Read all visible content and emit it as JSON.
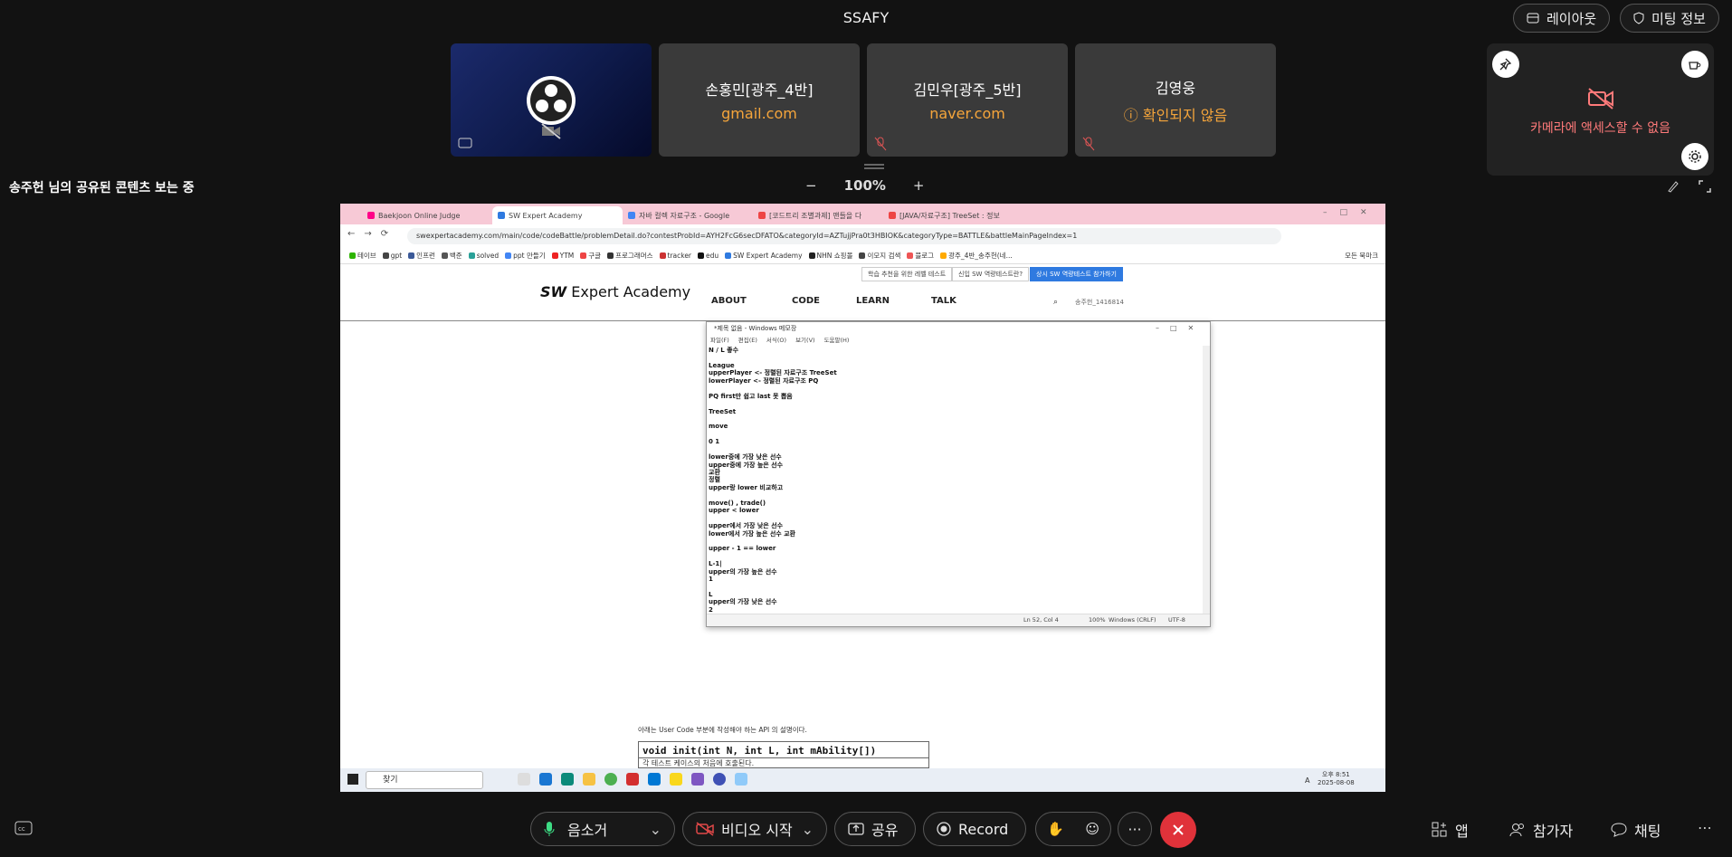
{
  "meeting": {
    "title": "SSAFY",
    "layout_button": "레이아웃",
    "info_button": "미팅 정보"
  },
  "participants": [
    {
      "name": "손홍민[광주_4반]",
      "sub": "gmail.com"
    },
    {
      "name": "김민우[광주_5반]",
      "sub": "naver.com"
    },
    {
      "name": "김영웅",
      "sub": "확인되지 않음"
    }
  ],
  "self_view": {
    "camera_message": "카메라에 액세스할 수 없음"
  },
  "share": {
    "label": "송주헌 님의 공유된 콘텐츠 보는 중",
    "zoom": "100%",
    "zoom_minus": "−",
    "zoom_plus": "+"
  },
  "browser": {
    "tabs": [
      {
        "label": "Baekjoon Online Judge"
      },
      {
        "label": "SW Expert Academy"
      },
      {
        "label": "자바 컬렉 자료구조 - Google"
      },
      {
        "label": "[코드트리 조별과제] 맨들을 다"
      },
      {
        "label": "[JAVA/자료구조] TreeSet : 정보"
      }
    ],
    "url": "swexpertacademy.com/main/code/codeBattle/problemDetail.do?contestProbId=AYH2FcG6secDFATO&categoryId=AZTujjPra0t3HBIOK&categoryType=BATTLE&battleMainPageIndex=1",
    "bookmarks": [
      "테이브",
      "gpt",
      "인프런",
      "백준",
      "solved",
      "ppt 만들기",
      "YTM",
      "구글",
      "프로그래머스",
      "tracker",
      "edu",
      "SW Expert Academy",
      "NHN 쇼핑몰",
      "이모지 검색",
      "블로그",
      "광주_4반_송주헌(네..."
    ],
    "all_bookmarks": "모든 북마크"
  },
  "swea": {
    "logo_sw": "SW",
    "logo_rest": " Expert Academy",
    "menu": [
      "ABOUT",
      "CODE",
      "LEARN",
      "TALK"
    ],
    "notices": [
      "학습 추천을 위한 레벨 테스트",
      "신입 SW 역량테스트란?",
      "상시 SW 역량테스트 참가하기"
    ],
    "user": "송주헌_1416814"
  },
  "notepad": {
    "title": "*제목 없음 - Windows 메모장",
    "menu": [
      "파일(F)",
      "편집(E)",
      "서식(O)",
      "보기(V)",
      "도움말(H)"
    ],
    "lines": [
      "N / L 좋수",
      "",
      "League",
      "upperPlayer <- 정렬된 자료구조 TreeSet",
      "lowerPlayer <- 정렬된 자료구조 PQ",
      "",
      "PQ first만 쉽고 last 못 뽑음",
      "",
      "TreeSet",
      "",
      "move",
      "",
      "0 1",
      "",
      "lower중에 가장 낮은 선수",
      "upper중에 가장 높은 선수",
      "교환",
      "정렬",
      "upper랑 lower 비교하고",
      "",
      "move() , trade()",
      "upper < lower",
      "",
      "upper에서 가장 낮은 선수",
      "lower에서 가장 높은 선수 교환",
      "",
      "upper - 1 == lower",
      "",
      "L-1|",
      "upper의 가장 높은 선수",
      "1",
      "",
      "L",
      "upper의 가장 낮은 선수",
      "2"
    ],
    "status": {
      "pos": "Ln 52, Col 4",
      "zoom": "100%",
      "eol": "Windows (CRLF)",
      "enc": "UTF-8"
    }
  },
  "api": {
    "desc": "아래는 User Code 부분에 작성해야 하는 API 의 설명이다.",
    "signature": "void init(int N, int L, int mAbility[])",
    "sub": "각 테스트 케이스의 처음에 호출된다."
  },
  "taskbar": {
    "search": "찾기",
    "time": "오후 8:51",
    "date": "2025-08-08",
    "ime": "A"
  },
  "controls": {
    "mute": "음소거",
    "video": "비디오 시작",
    "share": "공유",
    "record": "Record",
    "apps": "앱",
    "participants": "참가자",
    "chat": "채팅"
  },
  "colors": {
    "accent_orange": "#f5a53b",
    "leave_red": "#e0323a",
    "mic_green": "#3ddc84",
    "video_red": "#e04848",
    "cam_msg": "#ff7a7a"
  }
}
